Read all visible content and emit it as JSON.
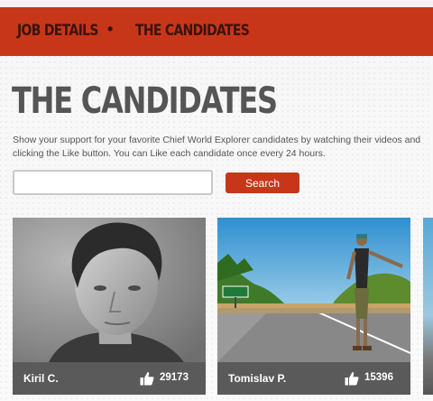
{
  "nav": {
    "items": [
      {
        "label": "JOB DETAILS"
      },
      {
        "label": "THE CANDIDATES"
      }
    ],
    "separator": "•"
  },
  "page": {
    "title": "THE CANDIDATES",
    "intro": "Show your support for your favorite Chief World Explorer candidates by watching their videos and clicking the Like button. You can Like each candidate once every 24 hours."
  },
  "search": {
    "value": "",
    "placeholder": "",
    "button_label": "Search"
  },
  "candidates": [
    {
      "name": "Kiril C.",
      "likes": "29173",
      "icon": "thumbs-up-icon"
    },
    {
      "name": "Tomislav P.",
      "likes": "15396",
      "icon": "thumbs-up-icon"
    }
  ],
  "colors": {
    "accent": "#c8361a",
    "nav_text": "#3a140c",
    "title_text": "#555555",
    "card_bar": "#5a5a5a"
  }
}
